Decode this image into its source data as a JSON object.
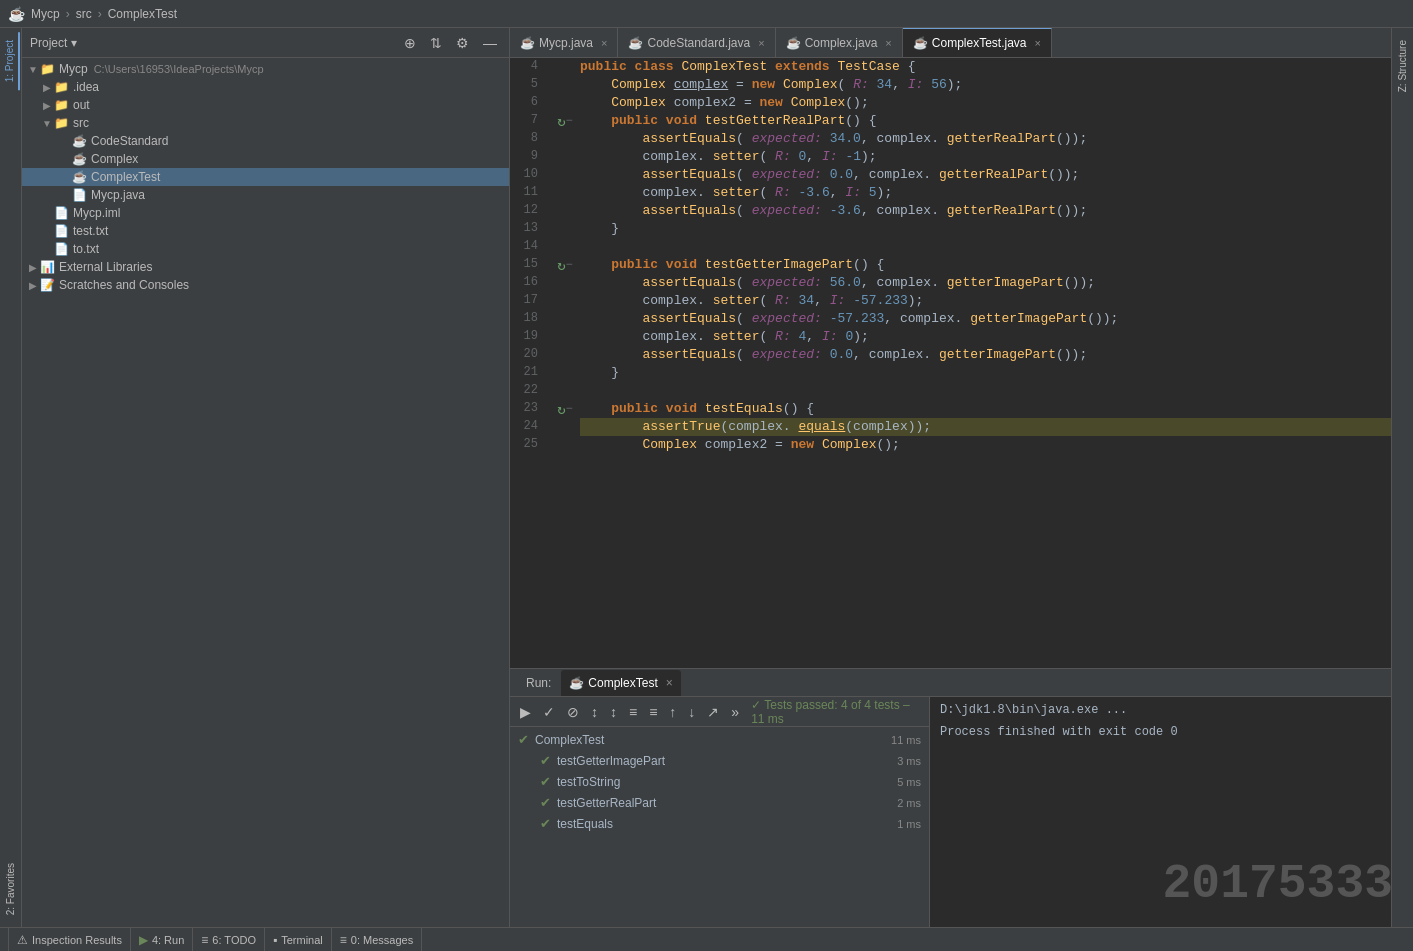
{
  "titleBar": {
    "icon": "☕",
    "parts": [
      "Mycp",
      "src",
      "ComplexTest"
    ]
  },
  "projectPanel": {
    "title": "Project",
    "actions": [
      "⊕",
      "≡",
      "⚙",
      "—"
    ],
    "tree": [
      {
        "id": "mycp-root",
        "label": "Mycp",
        "path": "C:\\Users\\16953\\IdeaProjects\\Mycp",
        "indent": 0,
        "type": "root",
        "expanded": true
      },
      {
        "id": "idea",
        "label": ".idea",
        "indent": 1,
        "type": "folder",
        "expanded": false
      },
      {
        "id": "out",
        "label": "out",
        "indent": 1,
        "type": "folder-yellow",
        "expanded": false
      },
      {
        "id": "src",
        "label": "src",
        "indent": 1,
        "type": "folder",
        "expanded": true
      },
      {
        "id": "codestandard",
        "label": "CodeStandard",
        "indent": 2,
        "type": "java"
      },
      {
        "id": "complex",
        "label": "Complex",
        "indent": 2,
        "type": "java"
      },
      {
        "id": "complextest",
        "label": "ComplexTest",
        "indent": 2,
        "type": "java",
        "selected": true
      },
      {
        "id": "mycp-java",
        "label": "Mycp.java",
        "indent": 2,
        "type": "java-file"
      },
      {
        "id": "mycp-iml",
        "label": "Mycp.iml",
        "indent": 1,
        "type": "iml"
      },
      {
        "id": "test-txt",
        "label": "test.txt",
        "indent": 1,
        "type": "txt"
      },
      {
        "id": "to-txt",
        "label": "to.txt",
        "indent": 1,
        "type": "txt"
      },
      {
        "id": "ext-libs",
        "label": "External Libraries",
        "indent": 0,
        "type": "ext-lib",
        "expanded": false
      },
      {
        "id": "scratches",
        "label": "Scratches and Consoles",
        "indent": 0,
        "type": "scratches",
        "expanded": false
      }
    ]
  },
  "tabs": [
    {
      "id": "mycp-java",
      "label": "Mycp.java",
      "icon": "☕",
      "active": false
    },
    {
      "id": "codestandard-java",
      "label": "CodeStandard.java",
      "icon": "☕",
      "active": false
    },
    {
      "id": "complex-java",
      "label": "Complex.java",
      "icon": "☕",
      "active": false
    },
    {
      "id": "complextest-java",
      "label": "ComplexTest.java",
      "icon": "☕",
      "active": true
    }
  ],
  "codeLines": [
    {
      "num": 4,
      "gutter": "",
      "content": "public_class_ComplexTest_extends_TestCase_{"
    },
    {
      "num": 5,
      "gutter": "",
      "content": "    Complex_complex_=_new_Complex(_R:_34,_I:_56);"
    },
    {
      "num": 6,
      "gutter": "",
      "content": "    Complex_complex2_=_new_Complex();"
    },
    {
      "num": 7,
      "gutter": "run+fold",
      "content": "    public_void_testGetterRealPart()_{"
    },
    {
      "num": 8,
      "gutter": "",
      "content": "        assertEquals(_expected:_34.0,_complex._getterRealPart());"
    },
    {
      "num": 9,
      "gutter": "",
      "content": "        complex._setter(_R:_0,_I:_-1);"
    },
    {
      "num": 10,
      "gutter": "",
      "content": "        assertEquals(_expected:_0.0,_complex._getterRealPart());"
    },
    {
      "num": 11,
      "gutter": "",
      "content": "        complex._setter(_R:_-3.6,_I:_5);"
    },
    {
      "num": 12,
      "gutter": "",
      "content": "        assertEquals(_expected:_-3.6,_complex._getterRealPart());"
    },
    {
      "num": 13,
      "gutter": "",
      "content": "    }"
    },
    {
      "num": 14,
      "gutter": "",
      "content": ""
    },
    {
      "num": 15,
      "gutter": "run+fold",
      "content": "    public_void_testGetterImagePart()_{"
    },
    {
      "num": 16,
      "gutter": "",
      "content": "        assertEquals(_expected:_56.0,_complex._getterImagePart());"
    },
    {
      "num": 17,
      "gutter": "",
      "content": "        complex._setter(_R:_34,_I:_-57.233);"
    },
    {
      "num": 18,
      "gutter": "",
      "content": "        assertEquals(_expected:_-57.233,_complex._getterImagePart());"
    },
    {
      "num": 19,
      "gutter": "",
      "content": "        complex._setter(_R:_4,_I:_0);"
    },
    {
      "num": 20,
      "gutter": "",
      "content": "        assertEquals(_expected:_0.0,_complex._getterImagePart());"
    },
    {
      "num": 21,
      "gutter": "",
      "content": "    }"
    },
    {
      "num": 22,
      "gutter": "",
      "content": ""
    },
    {
      "num": 23,
      "gutter": "run+fold",
      "content": "    public_void_testEquals()_{"
    },
    {
      "num": 24,
      "gutter": "",
      "content": "        assertTrue(complex._equals(complex));",
      "highlight": true
    },
    {
      "num": 25,
      "gutter": "",
      "content": "        Complex_complex2_=_new_Complex();"
    }
  ],
  "bottomPanel": {
    "runLabel": "Run:",
    "activeTab": "ComplexTest",
    "testStatus": "✓ Tests passed: 4 of 4 tests – 11 ms",
    "toolbar": [
      "▶",
      "✓",
      "⊘",
      "↕",
      "↕",
      "≡",
      "≡",
      "↑",
      "↓",
      "↗",
      "»"
    ],
    "suite": {
      "name": "ComplexTest",
      "time": "11 ms",
      "cases": [
        {
          "name": "testGetterImagePart",
          "time": "3 ms"
        },
        {
          "name": "testToString",
          "time": "5 ms"
        },
        {
          "name": "testGetterRealPart",
          "time": "2 ms"
        },
        {
          "name": "testEquals",
          "time": "1 ms"
        }
      ]
    },
    "output": {
      "cmd": "D:\\jdk1.8\\bin\\java.exe ...",
      "result": "Process finished with exit code 0"
    }
  },
  "statusBar": {
    "items": [
      {
        "icon": "⚠",
        "label": "Inspection Results"
      },
      {
        "icon": "▶",
        "label": "4: Run"
      },
      {
        "icon": "≡",
        "label": "6: TODO"
      },
      {
        "icon": "⬛",
        "label": "Terminal"
      },
      {
        "icon": "≡",
        "label": "0: Messages"
      }
    ]
  },
  "leftEdge": {
    "tabs": [
      {
        "label": "1: Project",
        "active": true
      },
      {
        "label": "2: Favorites",
        "active": false
      }
    ]
  },
  "rightEdge": {
    "tabs": [
      {
        "label": "Z: Structure",
        "active": false
      }
    ]
  },
  "watermark": "20175333"
}
